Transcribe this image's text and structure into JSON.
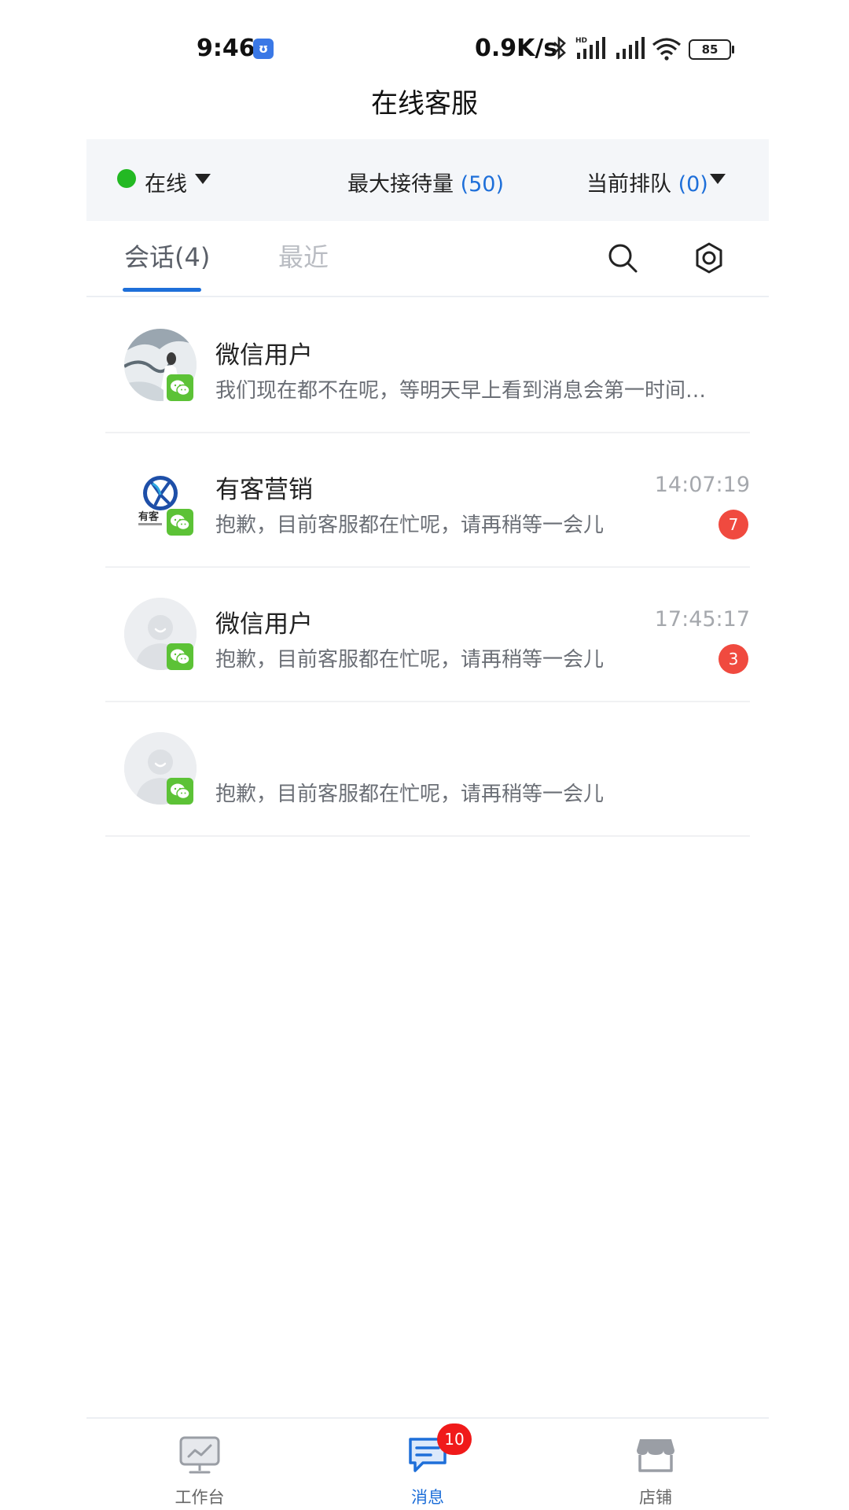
{
  "status_bar": {
    "time": "9:46",
    "app_badge": "ʊ",
    "net_speed": "0.9K/s",
    "battery": "85"
  },
  "header": {
    "title": "在线客服"
  },
  "status_panel": {
    "online_label": "在线",
    "max_receive_label": "最大接待量",
    "max_receive_value": "(50)",
    "queue_label": "当前排队",
    "queue_value": "(0)"
  },
  "tabs": [
    {
      "label": "会话(4)",
      "active": true
    },
    {
      "label": "最近",
      "active": false
    }
  ],
  "conversations": [
    {
      "name": "微信用户",
      "preview": "我们现在都不在呢，等明天早上看到消息会第一时间回复您",
      "time": "",
      "unread": "",
      "avatar": "photo-avatar"
    },
    {
      "name": "有客营销",
      "preview": "抱歉，目前客服都在忙呢，请再稍等一会儿",
      "time": "14:07:19",
      "unread": "7",
      "avatar": "logo-avatar",
      "logo_text": "有客"
    },
    {
      "name": "微信用户",
      "preview": "抱歉，目前客服都在忙呢，请再稍等一会儿",
      "time": "17:45:17",
      "unread": "3",
      "avatar": "default-avatar"
    },
    {
      "name": "",
      "preview": "抱歉，目前客服都在忙呢，请再稍等一会儿",
      "time": "",
      "unread": "",
      "avatar": "default-avatar"
    }
  ],
  "bottom_nav": {
    "workbench_label": "工作台",
    "messages_label": "消息",
    "messages_badge": "10",
    "shop_label": "店铺"
  },
  "colors": {
    "accent": "#1e6fd9",
    "online": "#23b923",
    "unread": "#f04a3f",
    "wechat": "#5cc236"
  }
}
